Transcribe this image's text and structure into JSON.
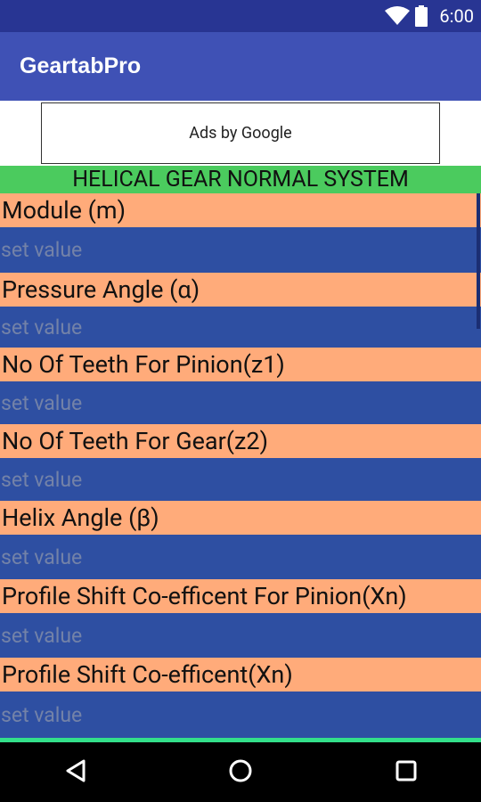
{
  "status_bar": {
    "time": "6:00",
    "wifi_icon": "wifi-icon",
    "battery_icon": "battery-icon"
  },
  "app_bar": {
    "title": "GeartabPro"
  },
  "ad": {
    "text": "Ads by Google"
  },
  "section": {
    "title": "HELICAL GEAR NORMAL SYSTEM"
  },
  "fields": [
    {
      "label": "Module (m)",
      "placeholder": "set value"
    },
    {
      "label": "Pressure Angle (α)",
      "placeholder": "set value"
    },
    {
      "label": "No Of Teeth For Pinion(z1)",
      "placeholder": "set value"
    },
    {
      "label": "No Of Teeth For Gear(z2)",
      "placeholder": "set value"
    },
    {
      "label": "Helix Angle (β)",
      "placeholder": "set value"
    },
    {
      "label": "Profile Shift Co-efficent For Pinion(Xn)",
      "placeholder": "set value"
    },
    {
      "label": "Profile Shift Co-efficent(Xn)",
      "placeholder": "set value"
    }
  ],
  "nav_bar": {
    "back_icon": "back-icon",
    "home_icon": "home-icon",
    "recents_icon": "recents-icon"
  },
  "colors": {
    "status_bar": "#283593",
    "app_bar": "#3f51b5",
    "section": "#4bcb5e",
    "label_bg": "#ffab7a",
    "input_bg": "#2e4fa2"
  }
}
